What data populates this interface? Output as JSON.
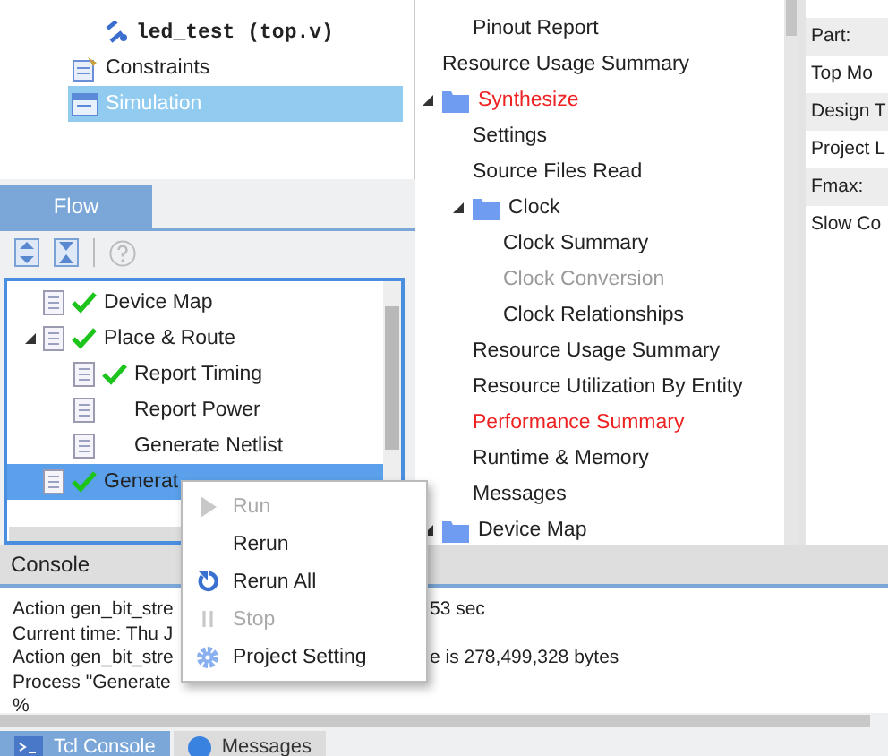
{
  "hierarchy": {
    "child_items": [
      {
        "label": "led_test (top.v)",
        "kind": "module",
        "selected": false
      }
    ],
    "items": [
      {
        "label": "Constraints",
        "kind": "constraints",
        "selected": false
      },
      {
        "label": "Simulation",
        "kind": "simulation",
        "selected": true
      }
    ]
  },
  "flow_tabs": [
    {
      "label": "Flow",
      "selected": true
    }
  ],
  "flow_tree": [
    {
      "label": "Device Map",
      "done": true,
      "selected": false
    },
    {
      "label": "Place & Route",
      "done": true,
      "selected": false,
      "expanded": true,
      "children": [
        {
          "label": "Report Timing",
          "done": true,
          "selected": false
        },
        {
          "label": "Report Power",
          "done": false,
          "selected": false
        },
        {
          "label": "Generate Netlist",
          "done": false,
          "selected": false
        }
      ]
    },
    {
      "label": "Generat",
      "done": true,
      "selected": true
    }
  ],
  "report_tree": {
    "child_items": [
      {
        "label": "Pinout Report",
        "color": "#222222"
      }
    ],
    "items": [
      {
        "label": "Resource Usage Summary",
        "color": "#222222"
      },
      {
        "label": "Synthesize",
        "color": "#ee2222",
        "expanded": true,
        "children": [
          {
            "label": "Settings",
            "color": "#222222"
          },
          {
            "label": "Source Files Read",
            "color": "#222222"
          },
          {
            "label": "Clock",
            "color": "#222222",
            "expanded": true,
            "children": [
              {
                "label": "Clock Summary",
                "color": "#222222"
              },
              {
                "label": "Clock Conversion",
                "color": "#9a9a9a"
              },
              {
                "label": "Clock Relationships",
                "color": "#222222"
              }
            ]
          },
          {
            "label": "Resource Usage Summary",
            "color": "#222222"
          },
          {
            "label": "Resource Utilization By Entity",
            "color": "#222222"
          },
          {
            "label": "Performance Summary",
            "color": "#ee2222"
          },
          {
            "label": "Runtime & Memory",
            "color": "#222222"
          },
          {
            "label": "Messages",
            "color": "#222222"
          }
        ]
      },
      {
        "label": "Device Map",
        "color": "#222222",
        "expanded": true
      }
    ]
  },
  "properties": [
    "Part:",
    "Top Mo",
    "Design T",
    "Project L",
    "Fmax:",
    "Slow Co"
  ],
  "console": {
    "title": "Console",
    "lines": [
      {
        "left": "Action gen_bit_stre",
        "right": "53 sec"
      },
      {
        "left": "Current time: Thu J"
      },
      {
        "left": "Action gen_bit_stre",
        "right": "e is 278,499,328 bytes"
      },
      {
        "left": "Process \"Generate"
      },
      {
        "left": "%"
      }
    ]
  },
  "bottom_tabs": [
    {
      "label": "Tcl Console",
      "kind": "tcl",
      "selected": true
    },
    {
      "label": "Messages",
      "kind": "messages",
      "selected": false
    }
  ],
  "context_menu": [
    {
      "label": "Run",
      "kind": "run",
      "disabled": true
    },
    {
      "label": "Rerun",
      "kind": "rerun",
      "disabled": false
    },
    {
      "label": "Rerun All",
      "kind": "rerun_all",
      "disabled": false
    },
    {
      "label": "Stop",
      "kind": "stop",
      "disabled": true
    },
    {
      "label": "Project Setting",
      "kind": "settings",
      "disabled": false
    }
  ]
}
